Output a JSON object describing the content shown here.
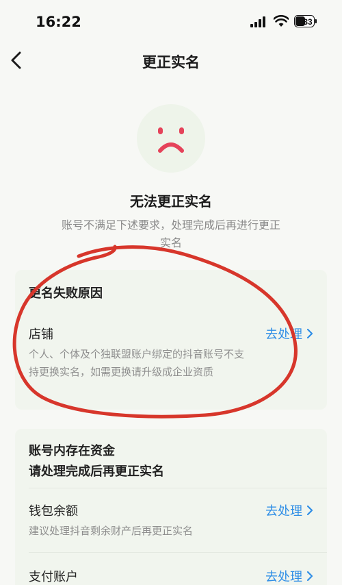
{
  "status_bar": {
    "time": "16:22",
    "battery_level": "33"
  },
  "nav": {
    "title": "更正实名"
  },
  "result": {
    "title": "无法更正实名",
    "description": "账号不满足下述要求，处理完成后再进行更正实名"
  },
  "failure_card": {
    "heading": "更名失败原因",
    "items": [
      {
        "title": "店铺",
        "description": "个人、个体及个独联盟账户绑定的抖音账号不支持更换实名，如需更换请升级成企业资质",
        "action": "去处理"
      }
    ]
  },
  "funds_card": {
    "heading_line1": "账号内存在资金",
    "heading_line2": "请处理完成后再更正实名",
    "items": [
      {
        "title": "钱包余额",
        "description": "建议处理抖音剩余财产后再更正实名",
        "action": "去处理"
      },
      {
        "title": "支付账户",
        "description": "",
        "action": "去处理"
      }
    ]
  },
  "colors": {
    "accent": "#2f8ee6",
    "sad_face": "#e5435a",
    "annotation_circle": "#d7362b"
  },
  "icons": [
    "back-chevron-icon",
    "cellular-signal-icon",
    "wifi-icon",
    "battery-icon",
    "sad-face-icon",
    "chevron-right-icon"
  ]
}
